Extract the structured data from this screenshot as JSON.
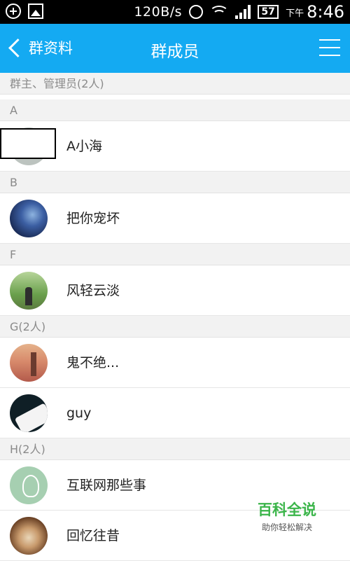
{
  "status_bar": {
    "speed": "120B/s",
    "battery": "57",
    "ampm": "下午",
    "time": "8:46"
  },
  "header": {
    "back_label": "群资料",
    "title": "群成员"
  },
  "sections": [
    {
      "label": "群主、管理员(2人)",
      "members": []
    },
    {
      "label": "A",
      "members": [
        {
          "name": "A小海",
          "avatar": "redacted-avatar"
        }
      ]
    },
    {
      "label": "B",
      "members": [
        {
          "name": "把你宠坏",
          "avatar": "starry-sky"
        }
      ]
    },
    {
      "label": "F",
      "members": [
        {
          "name": "风轻云淡",
          "avatar": "person-in-garden"
        }
      ]
    },
    {
      "label": "G(2人)",
      "members": [
        {
          "name": "鬼不绝...",
          "avatar": "sunset-beach"
        },
        {
          "name": "guy",
          "avatar": "white-cap-dark"
        }
      ]
    },
    {
      "label": "H(2人)",
      "members": [
        {
          "name": "互联网那些事",
          "avatar": "sketch-portrait-green"
        },
        {
          "name": "回忆往昔",
          "avatar": "latte-art"
        }
      ]
    }
  ],
  "watermark": {
    "title": "百科全说",
    "subtitle": "助你轻松解决"
  }
}
